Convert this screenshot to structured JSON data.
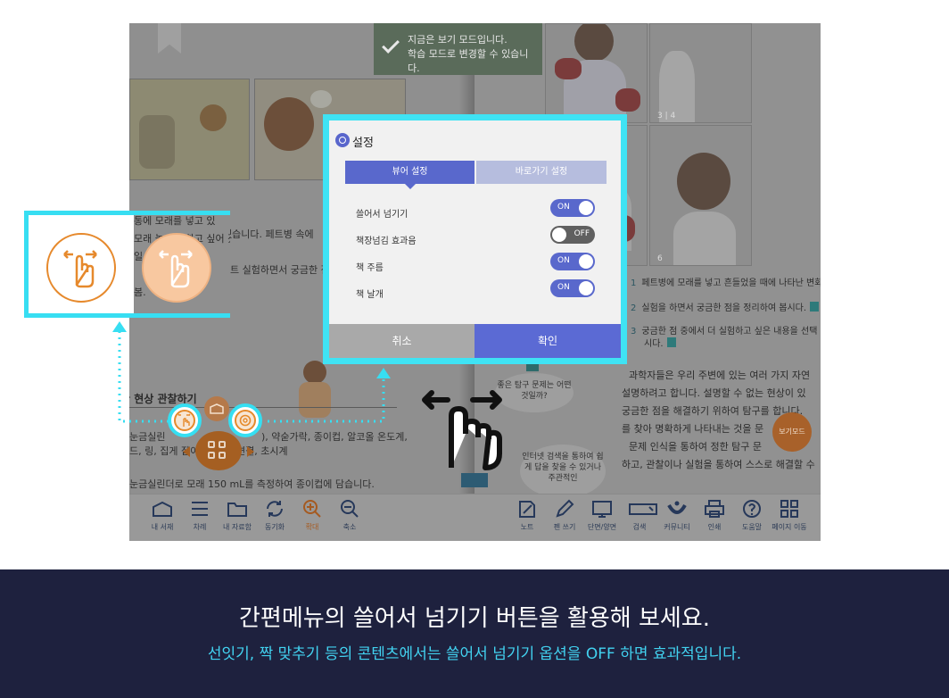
{
  "toast": {
    "line1": "지금은 보기 모드입니다.",
    "line2": "학습 모드로 변경할 수 있습니다."
  },
  "left_page": {
    "text_lines": [
      "통에 모래를 넣고 있",
      "모래 놀이가 하고 싶어 졌습니다. 페트병 속에",
      "일",
      "트 실험하면서 궁금한 점을 ",
      "봄."
    ],
    "section_title": "한 현상 관찰하기",
    "materials_1": "눈금실린",
    "materials_1b": "), 약숟가락, 종이컵, 알코올 온도계,",
    "materials_2": "드, 링, 집게 잡이,",
    "materials_2b": "연결, 초시계",
    "step": "눈금실린더로 모래 150 mL를 측정하여 종이컵에 담습니다."
  },
  "center": {
    "bubble_1": "좋은 탐구 문제는 어떤 것일까?",
    "bubble_2": "인터넷 검색을 통하여 쉽게 답을 찾을 수 있거나 주관적인"
  },
  "right_page": {
    "photo_nums": [
      "3 | 4",
      "6"
    ],
    "items": [
      {
        "num": "1",
        "text": "페트병에 모래를 넣고 흔들었을 때에 나타난 변화"
      },
      {
        "num": "2",
        "text": "실험을 하면서 궁금한 점을 정리하여 봅시다."
      },
      {
        "num": "3",
        "text": "궁금한 점 중에서 더 실험하고 싶은 내용을 선택"
      },
      {
        "num": "",
        "text": "시다."
      }
    ],
    "body": [
      "과학자들은 우리 주변에 있는 여러 가지 자연",
      "설명하려고 합니다. 설명할 수 없는 현상이 있",
      "궁금한 점을 해결하기 위하여 탐구를 합니다.",
      "를 찾아 명확하게 나타내는 것을 문",
      "문제 인식을 통하여 정한 탐구 문",
      "하고, 관찰이나 실험을 통하여 스스로 해결할 수"
    ],
    "view_mode_label": "보기모드"
  },
  "dialog": {
    "title": "설정",
    "tabs": [
      "뷰어 설정",
      "바로가기 설정"
    ],
    "settings": [
      {
        "label": "쓸어서 넘기기",
        "state": "ON"
      },
      {
        "label": "책장넘김 효과음",
        "state": "OFF"
      },
      {
        "label": "책 주름",
        "state": "ON"
      },
      {
        "label": "책 날개",
        "state": "ON"
      }
    ],
    "cancel": "취소",
    "confirm": "확인"
  },
  "toolbar": {
    "left": [
      {
        "icon": "my-library-icon",
        "label": "내 서재"
      },
      {
        "icon": "toc-icon",
        "label": "차례"
      },
      {
        "icon": "folder-icon",
        "label": "내 자료함"
      },
      {
        "icon": "sync-icon",
        "label": "동기화"
      },
      {
        "icon": "zoom-in-icon",
        "label": "확대"
      },
      {
        "icon": "zoom-out-icon",
        "label": "축소"
      }
    ],
    "right": [
      {
        "icon": "note-icon",
        "label": "노트"
      },
      {
        "icon": "pen-icon",
        "label": "펜 쓰기"
      },
      {
        "icon": "single-double-page-icon",
        "label": "단면/양면"
      },
      {
        "icon": "search-icon",
        "label": "검색"
      },
      {
        "icon": "community-icon",
        "label": "커뮤니티"
      },
      {
        "icon": "print-icon",
        "label": "인쇄"
      },
      {
        "icon": "help-icon",
        "label": "도움말"
      },
      {
        "icon": "page-move-icon",
        "label": "페이지 이동"
      }
    ],
    "active_color": "#a55a20",
    "icon_color": "#26385a"
  },
  "colors": {
    "highlight": "#37def2",
    "accent_orange": "#e6892c",
    "dialog_blue": "#5968cc",
    "banner_bg": "#1e213e",
    "banner_sub": "#42d2f0"
  },
  "banner": {
    "title": "간편메뉴의 쓸어서 넘기기 버튼을 활용해 보세요.",
    "subtitle": "선잇기, 짝 맞추기 등의 콘텐츠에서는  쓸어서 넘기기 옵션을 OFF 하면 효과적입니다."
  }
}
